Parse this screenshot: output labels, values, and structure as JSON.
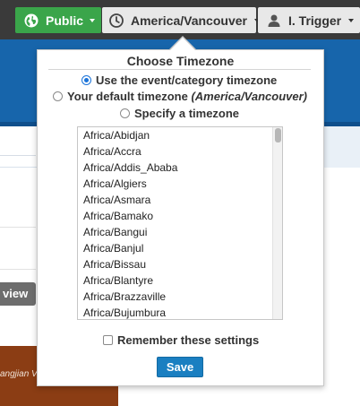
{
  "toolbar": {
    "public_label": "Public",
    "timezone_label": "America/Vancouver",
    "user_label": "I. Trigger"
  },
  "background": {
    "view_label": "view",
    "caption_text": "angjian V"
  },
  "timezone_popover": {
    "title": "Choose Timezone",
    "options": {
      "event_category": "Use the event/category timezone",
      "default_prefix": "Your default timezone ",
      "default_value": "(America/Vancouver)",
      "specify": "Specify a timezone"
    },
    "selected_option": "event_category",
    "timezones": [
      "Africa/Abidjan",
      "Africa/Accra",
      "Africa/Addis_Ababa",
      "Africa/Algiers",
      "Africa/Asmara",
      "Africa/Bamako",
      "Africa/Bangui",
      "Africa/Banjul",
      "Africa/Bissau",
      "Africa/Blantyre",
      "Africa/Brazzaville",
      "Africa/Bujumbura"
    ],
    "remember_label": "Remember these settings",
    "remember_checked": false,
    "save_label": "Save"
  },
  "colors": {
    "public_button": "#3aa54a",
    "header_blue": "#1765ab",
    "save_button": "#1a7fc1",
    "radio_selected": "#1a73d9"
  },
  "icons": {
    "public": "globe-icon",
    "timezone": "clock-icon",
    "user": "user-icon"
  }
}
